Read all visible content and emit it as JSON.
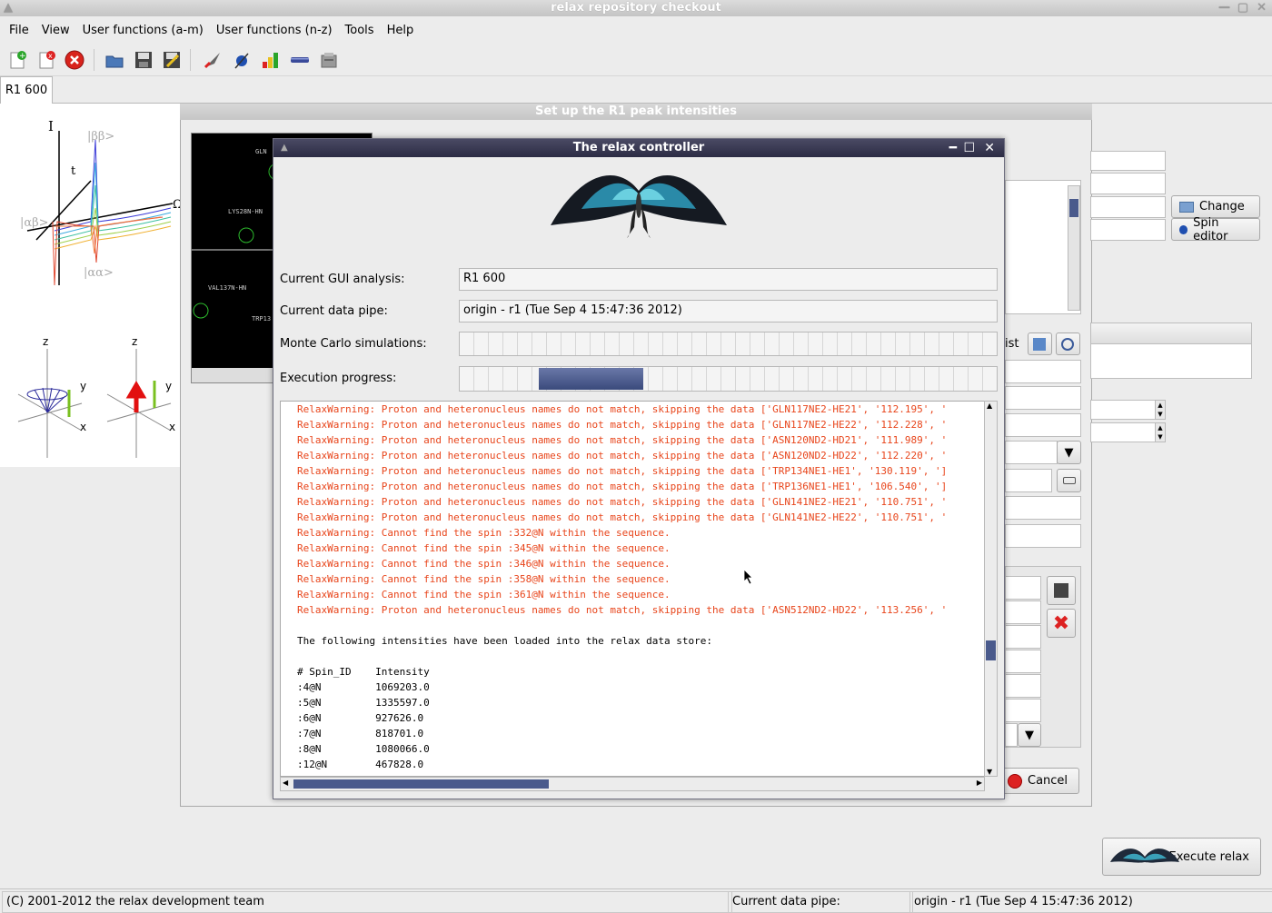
{
  "window": {
    "title": "relax repository checkout"
  },
  "menu": [
    "File",
    "View",
    "User functions (a-m)",
    "User functions (n-z)",
    "Tools",
    "Help"
  ],
  "toolbar": {
    "icons": [
      "new-analysis-icon",
      "close-analysis-icon",
      "close-all-icon",
      "open-icon",
      "save-icon",
      "save-as-icon",
      "controller-icon",
      "spin-viewer-icon",
      "results-viewer-icon",
      "pipe-editor-icon",
      "prompt-icon"
    ]
  },
  "tabs": [
    {
      "label": "R1 600"
    }
  ],
  "bg_dialog": {
    "title": "Set up the R1 peak intensities",
    "change_label": "Change",
    "spin_editor_label": "Spin editor",
    "list_fragment": "ist",
    "cancel_label": "Cancel"
  },
  "execute": {
    "label": "Execute relax"
  },
  "spectrum": {
    "peak_labels": [
      "GLN",
      "LYS28N-HN",
      "VAL137N-HN",
      "TRP13"
    ]
  },
  "left_panel": {
    "labels": [
      "I",
      "|ββ>",
      "t",
      "|αβ>",
      "|αα>",
      "Ω",
      "z",
      "y",
      "x",
      "z",
      "y",
      "x"
    ]
  },
  "controller": {
    "title": "The relax controller",
    "analysis_label": "Current GUI analysis:",
    "analysis_value": "R1 600",
    "pipe_label": "Current data pipe:",
    "pipe_value": "origin - r1 (Tue Sep  4 15:47:36 2012)",
    "mc_label": "Monte Carlo simulations:",
    "progress_label": "Execution progress:",
    "progress_fraction": 0.15,
    "log": [
      {
        "type": "warn",
        "text": "RelaxWarning: Proton and heteronucleus names do not match, skipping the data ['GLN117NE2-HE21', '112.195', '"
      },
      {
        "type": "warn",
        "text": "RelaxWarning: Proton and heteronucleus names do not match, skipping the data ['GLN117NE2-HE22', '112.228', '"
      },
      {
        "type": "warn",
        "text": "RelaxWarning: Proton and heteronucleus names do not match, skipping the data ['ASN120ND2-HD21', '111.989', '"
      },
      {
        "type": "warn",
        "text": "RelaxWarning: Proton and heteronucleus names do not match, skipping the data ['ASN120ND2-HD22', '112.220', '"
      },
      {
        "type": "warn",
        "text": "RelaxWarning: Proton and heteronucleus names do not match, skipping the data ['TRP134NE1-HE1', '130.119', ']"
      },
      {
        "type": "warn",
        "text": "RelaxWarning: Proton and heteronucleus names do not match, skipping the data ['TRP136NE1-HE1', '106.540', ']"
      },
      {
        "type": "warn",
        "text": "RelaxWarning: Proton and heteronucleus names do not match, skipping the data ['GLN141NE2-HE21', '110.751', '"
      },
      {
        "type": "warn",
        "text": "RelaxWarning: Proton and heteronucleus names do not match, skipping the data ['GLN141NE2-HE22', '110.751', '"
      },
      {
        "type": "warn",
        "text": "RelaxWarning: Cannot find the spin :332@N within the sequence."
      },
      {
        "type": "warn",
        "text": "RelaxWarning: Cannot find the spin :345@N within the sequence."
      },
      {
        "type": "warn",
        "text": "RelaxWarning: Cannot find the spin :346@N within the sequence."
      },
      {
        "type": "warn",
        "text": "RelaxWarning: Cannot find the spin :358@N within the sequence."
      },
      {
        "type": "warn",
        "text": "RelaxWarning: Cannot find the spin :361@N within the sequence."
      },
      {
        "type": "warn",
        "text": "RelaxWarning: Proton and heteronucleus names do not match, skipping the data ['ASN512ND2-HD22', '113.256', '"
      },
      {
        "type": "plain",
        "text": ""
      },
      {
        "type": "plain",
        "text": "The following intensities have been loaded into the relax data store:"
      },
      {
        "type": "plain",
        "text": ""
      },
      {
        "type": "plain",
        "text": "# Spin_ID    Intensity"
      },
      {
        "type": "plain",
        "text": ":4@N         1069203.0"
      },
      {
        "type": "plain",
        "text": ":5@N         1335597.0"
      },
      {
        "type": "plain",
        "text": ":6@N         927626.0"
      },
      {
        "type": "plain",
        "text": ":7@N         818701.0"
      },
      {
        "type": "plain",
        "text": ":8@N         1080066.0"
      },
      {
        "type": "plain",
        "text": ":12@N        467828.0"
      }
    ]
  },
  "status": {
    "copyright": "(C) 2001-2012 the relax development team",
    "pipe_label": "Current data pipe:",
    "pipe_value": "origin - r1 (Tue Sep  4 15:47:36 2012)"
  },
  "colors": {
    "warning": "#e8451b",
    "titlebar_active": "#2c2c44",
    "progress": "#4a5a8c"
  }
}
